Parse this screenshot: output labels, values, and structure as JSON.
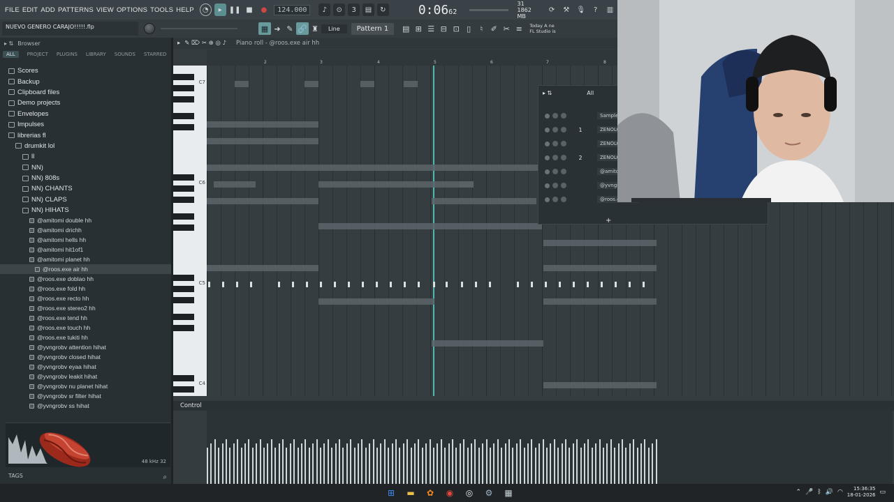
{
  "menubar": {
    "items": [
      "FILE",
      "EDIT",
      "ADD",
      "PATTERNS",
      "VIEW",
      "OPTIONS",
      "TOOLS",
      "HELP"
    ],
    "tempo": "124.000",
    "time": "0:06",
    "time_small": "62",
    "cpu": "1862 MB",
    "cpu_num": "31"
  },
  "toolbar2": {
    "project_hint": "NUEVO GENERO CARAJO!!!!!.flp",
    "line_mode": "Line",
    "pattern": "Pattern 1",
    "news_line1": "Today  A ne",
    "news_line2": "FL Studio is"
  },
  "browser": {
    "title": "Browser",
    "tabs": [
      "ALL",
      "PROJECT",
      "PLUGINS",
      "LIBRARY",
      "SOUNDS",
      "STARRED"
    ],
    "items": [
      {
        "label": "Scores",
        "indent": 12,
        "kind": "folder",
        "small": false
      },
      {
        "label": "Backup",
        "indent": 12,
        "kind": "folder",
        "small": false
      },
      {
        "label": "Clipboard files",
        "indent": 12,
        "kind": "folder",
        "small": false
      },
      {
        "label": "Demo projects",
        "indent": 12,
        "kind": "folder",
        "small": false
      },
      {
        "label": "Envelopes",
        "indent": 12,
        "kind": "folder",
        "small": false
      },
      {
        "label": "Impulses",
        "indent": 12,
        "kind": "folder",
        "small": false
      },
      {
        "label": "librerias fl",
        "indent": 12,
        "kind": "folder",
        "small": false
      },
      {
        "label": "drumkit lol",
        "indent": 22,
        "kind": "folder",
        "small": false
      },
      {
        "label": "ll",
        "indent": 32,
        "kind": "folder",
        "small": false
      },
      {
        "label": "NN)",
        "indent": 32,
        "kind": "folder",
        "small": false
      },
      {
        "label": "NN)          808s",
        "indent": 32,
        "kind": "folder",
        "small": false
      },
      {
        "label": "NN)          CHANTS",
        "indent": 32,
        "kind": "folder",
        "small": false
      },
      {
        "label": "NN)          CLAPS",
        "indent": 32,
        "kind": "folder",
        "small": false
      },
      {
        "label": "NN)          HIHATS",
        "indent": 32,
        "kind": "folder",
        "small": false
      },
      {
        "label": "@amitomi double hh",
        "indent": 42,
        "kind": "file",
        "small": true
      },
      {
        "label": "@amitomi drichh",
        "indent": 42,
        "kind": "file",
        "small": true
      },
      {
        "label": "@amitomi hells hh",
        "indent": 42,
        "kind": "file",
        "small": true
      },
      {
        "label": "@amitomi hit1of1",
        "indent": 42,
        "kind": "file",
        "small": true
      },
      {
        "label": "@amitomi planet hh",
        "indent": 42,
        "kind": "file",
        "small": true
      },
      {
        "label": "@roos.exe air hh",
        "indent": 50,
        "kind": "file",
        "small": true,
        "selected": true
      },
      {
        "label": "@roos.exe doblao hh",
        "indent": 42,
        "kind": "file",
        "small": true
      },
      {
        "label": "@roos.exe fold hh",
        "indent": 42,
        "kind": "file",
        "small": true
      },
      {
        "label": "@roos.exe recto hh",
        "indent": 42,
        "kind": "file",
        "small": true
      },
      {
        "label": "@roos.exe stereo2 hh",
        "indent": 42,
        "kind": "file",
        "small": true
      },
      {
        "label": "@roos.exe tend hh",
        "indent": 42,
        "kind": "file",
        "small": true
      },
      {
        "label": "@roos.exe touch hh",
        "indent": 42,
        "kind": "file",
        "small": true
      },
      {
        "label": "@roos.exe tukiti hh",
        "indent": 42,
        "kind": "file",
        "small": true
      },
      {
        "label": "@yvngrobv attention hihat",
        "indent": 42,
        "kind": "file",
        "small": true
      },
      {
        "label": "@yvngrobv closed hihat",
        "indent": 42,
        "kind": "file",
        "small": true
      },
      {
        "label": "@yvngrobv eyaa hihat",
        "indent": 42,
        "kind": "file",
        "small": true
      },
      {
        "label": "@yvngrobv leakit hihat",
        "indent": 42,
        "kind": "file",
        "small": true
      },
      {
        "label": "@yvngrobv nu planet hihat",
        "indent": 42,
        "kind": "file",
        "small": true
      },
      {
        "label": "@yvngrobv sr filter hihat",
        "indent": 42,
        "kind": "file",
        "small": true
      },
      {
        "label": "@yvngrobv ss hihat",
        "indent": 42,
        "kind": "file",
        "small": true
      }
    ],
    "sample_rate": "48 kHz 32",
    "tags_label": "TAGS"
  },
  "pianoroll": {
    "title": "Piano roll - @roos.exe air hh",
    "ruler": [
      "2",
      "3",
      "4",
      "5",
      "6",
      "7",
      "8"
    ],
    "keys": [
      "C7",
      "C6",
      "C5",
      "C4"
    ],
    "control_label": "Control"
  },
  "rack": {
    "filter": "All",
    "channels": [
      {
        "num": "",
        "name": "Sampler"
      },
      {
        "num": "1",
        "name": "ZENOLOGY"
      },
      {
        "num": "",
        "name": "ZENOLOGY"
      },
      {
        "num": "2",
        "name": "ZENOLOGY"
      },
      {
        "num": "",
        "name": "@amito..ch"
      },
      {
        "num": "",
        "name": "@yvngr..sn"
      },
      {
        "num": "",
        "name": "@roos.e..air"
      }
    ]
  },
  "taskbar": {
    "time": "15:36:35",
    "date": "18-01-2026"
  },
  "colors": {
    "accent": "#4fb8b0",
    "panel": "#283034",
    "grid": "#353d41"
  }
}
